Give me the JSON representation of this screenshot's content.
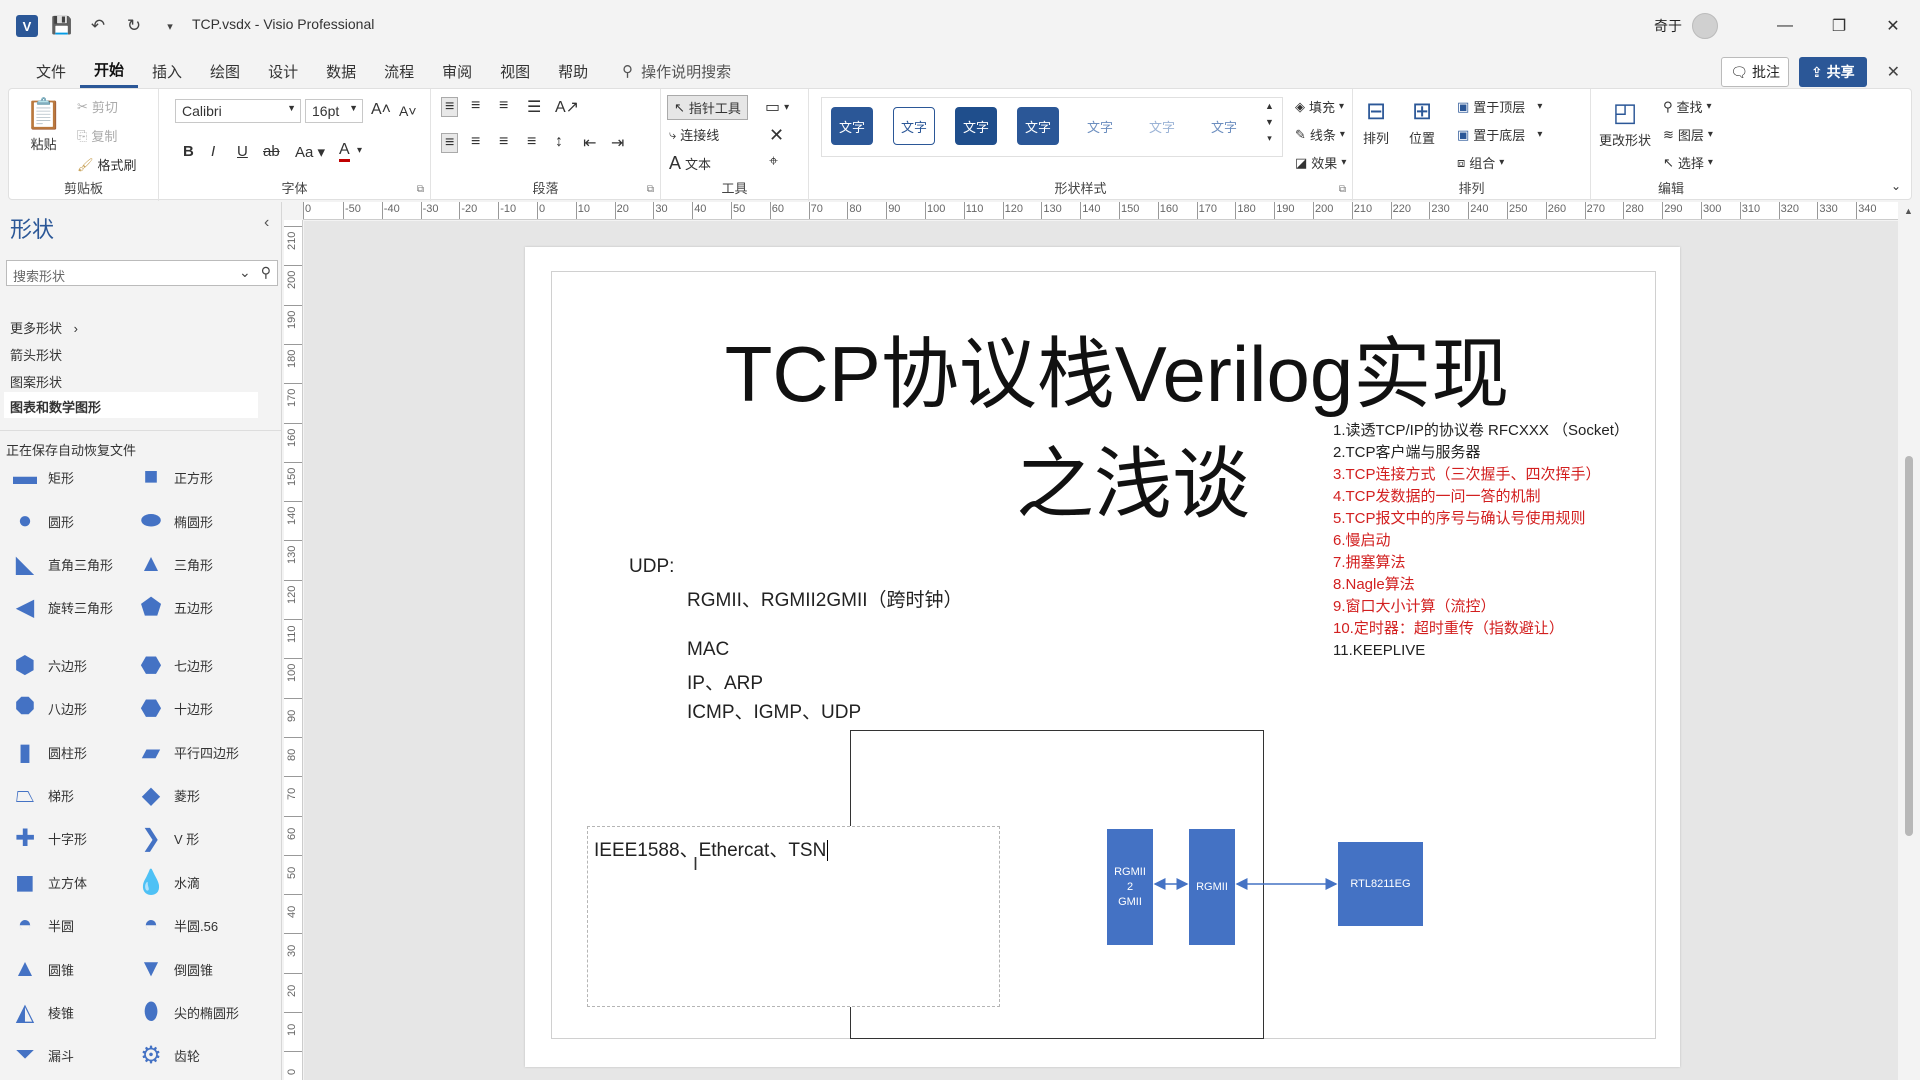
{
  "titlebar": {
    "app_icon": "V",
    "doc_title": "TCP.vsdx  -  Visio Professional",
    "user_name": "奇于"
  },
  "menu": {
    "tabs": [
      "文件",
      "开始",
      "插入",
      "绘图",
      "设计",
      "数据",
      "流程",
      "审阅",
      "视图",
      "帮助"
    ],
    "active_tab": "开始",
    "tell_me": "操作说明搜索",
    "comment": "批注",
    "share": "共享"
  },
  "ribbon": {
    "clipboard": {
      "paste": "粘贴",
      "cut": "剪切",
      "copy": "复制",
      "format_painter": "格式刷",
      "label": "剪贴板"
    },
    "font": {
      "family": "Calibri",
      "size": "16pt",
      "label": "字体"
    },
    "paragraph": {
      "label": "段落"
    },
    "tools": {
      "pointer": "指针工具",
      "connector": "连接线",
      "text": "文本",
      "label": "工具"
    },
    "shape_styles": {
      "swatch_text": "文字",
      "label": "形状样式",
      "fill": "填充",
      "line": "线条",
      "effects": "效果"
    },
    "arrange": {
      "align": "排列",
      "position": "位置",
      "bring_front": "置于顶层",
      "send_back": "置于底层",
      "group": "组合",
      "label": "排列"
    },
    "editing": {
      "change_shape": "更改形状",
      "find": "查找",
      "layers": "图层",
      "select": "选择",
      "label": "编辑"
    }
  },
  "shapes_pane": {
    "title": "形状",
    "search_placeholder": "搜索形状",
    "more_shapes": "更多形状",
    "stencils": [
      "箭头形状",
      "图案形状",
      "图表和数学图形"
    ],
    "autosave": "正在保存自动恢复文件",
    "shapes": [
      [
        "矩形",
        "正方形"
      ],
      [
        "圆形",
        "椭圆形"
      ],
      [
        "直角三角形",
        "三角形"
      ],
      [
        "旋转三角形",
        "五边形"
      ],
      [
        "六边形",
        "七边形"
      ],
      [
        "八边形",
        "十边形"
      ],
      [
        "圆柱形",
        "平行四边形"
      ],
      [
        "梯形",
        "菱形"
      ],
      [
        "十字形",
        "V 形"
      ],
      [
        "立方体",
        "水滴"
      ],
      [
        "半圆",
        "半圆.56"
      ],
      [
        "圆锥",
        "倒圆锥"
      ],
      [
        "棱锥",
        "尖的椭圆形"
      ],
      [
        "漏斗",
        "齿轮"
      ]
    ]
  },
  "rulers": {
    "top": [
      "0",
      "-50",
      "-40",
      "-30",
      "-20",
      "-10",
      "0",
      "10",
      "20",
      "30",
      "40",
      "50",
      "60",
      "70",
      "80",
      "90",
      "100",
      "110",
      "120",
      "130",
      "140",
      "150",
      "160",
      "170",
      "180",
      "190",
      "200",
      "210",
      "220",
      "230",
      "240",
      "250",
      "260",
      "270",
      "280",
      "290",
      "300",
      "310",
      "320",
      "330",
      "340"
    ],
    "left": [
      "210",
      "200",
      "190",
      "180",
      "170",
      "160",
      "150",
      "140",
      "130",
      "120",
      "110",
      "100",
      "90",
      "80",
      "70",
      "60",
      "50",
      "40",
      "30",
      "20",
      "10",
      "0"
    ]
  },
  "diagram": {
    "title_line1": "TCP协议栈Verilog实现",
    "title_line2": "之浅谈",
    "udp_label": "UDP:",
    "udp_lines": [
      "RGMII、RGMII2GMII（跨时钟）",
      "MAC",
      "IP、ARP",
      "ICMP、IGMP、UDP"
    ],
    "topics": [
      {
        "text": "1.读透TCP/IP的协议卷 RFCXXX （Socket）",
        "color": "#222222"
      },
      {
        "text": "2.TCP客户端与服务器",
        "color": "#222222"
      },
      {
        "text": "3.TCP连接方式（三次握手、四次挥手）",
        "color": "#d21f1f"
      },
      {
        "text": "4.TCP发数据的一问一答的机制",
        "color": "#d21f1f"
      },
      {
        "text": "5.TCP报文中的序号与确认号使用规则",
        "color": "#d21f1f"
      },
      {
        "text": "6.慢启动",
        "color": "#d21f1f"
      },
      {
        "text": "7.拥塞算法",
        "color": "#d21f1f"
      },
      {
        "text": "8.Nagle算法",
        "color": "#d21f1f"
      },
      {
        "text": "9.窗口大小计算（流控）",
        "color": "#d21f1f"
      },
      {
        "text": "10.定时器：超时重传（指数避让）",
        "color": "#d21f1f"
      },
      {
        "text": "11.KEEPLIVE",
        "color": "#222222"
      }
    ],
    "textbox_text": "IEEE1588、Ethercat、TSN",
    "blocks": {
      "rgmii2gmii": "RGMII\n2\nGMII",
      "rgmii": "RGMII",
      "phy": "RTL8211EG"
    },
    "accent": "#4472c4"
  }
}
